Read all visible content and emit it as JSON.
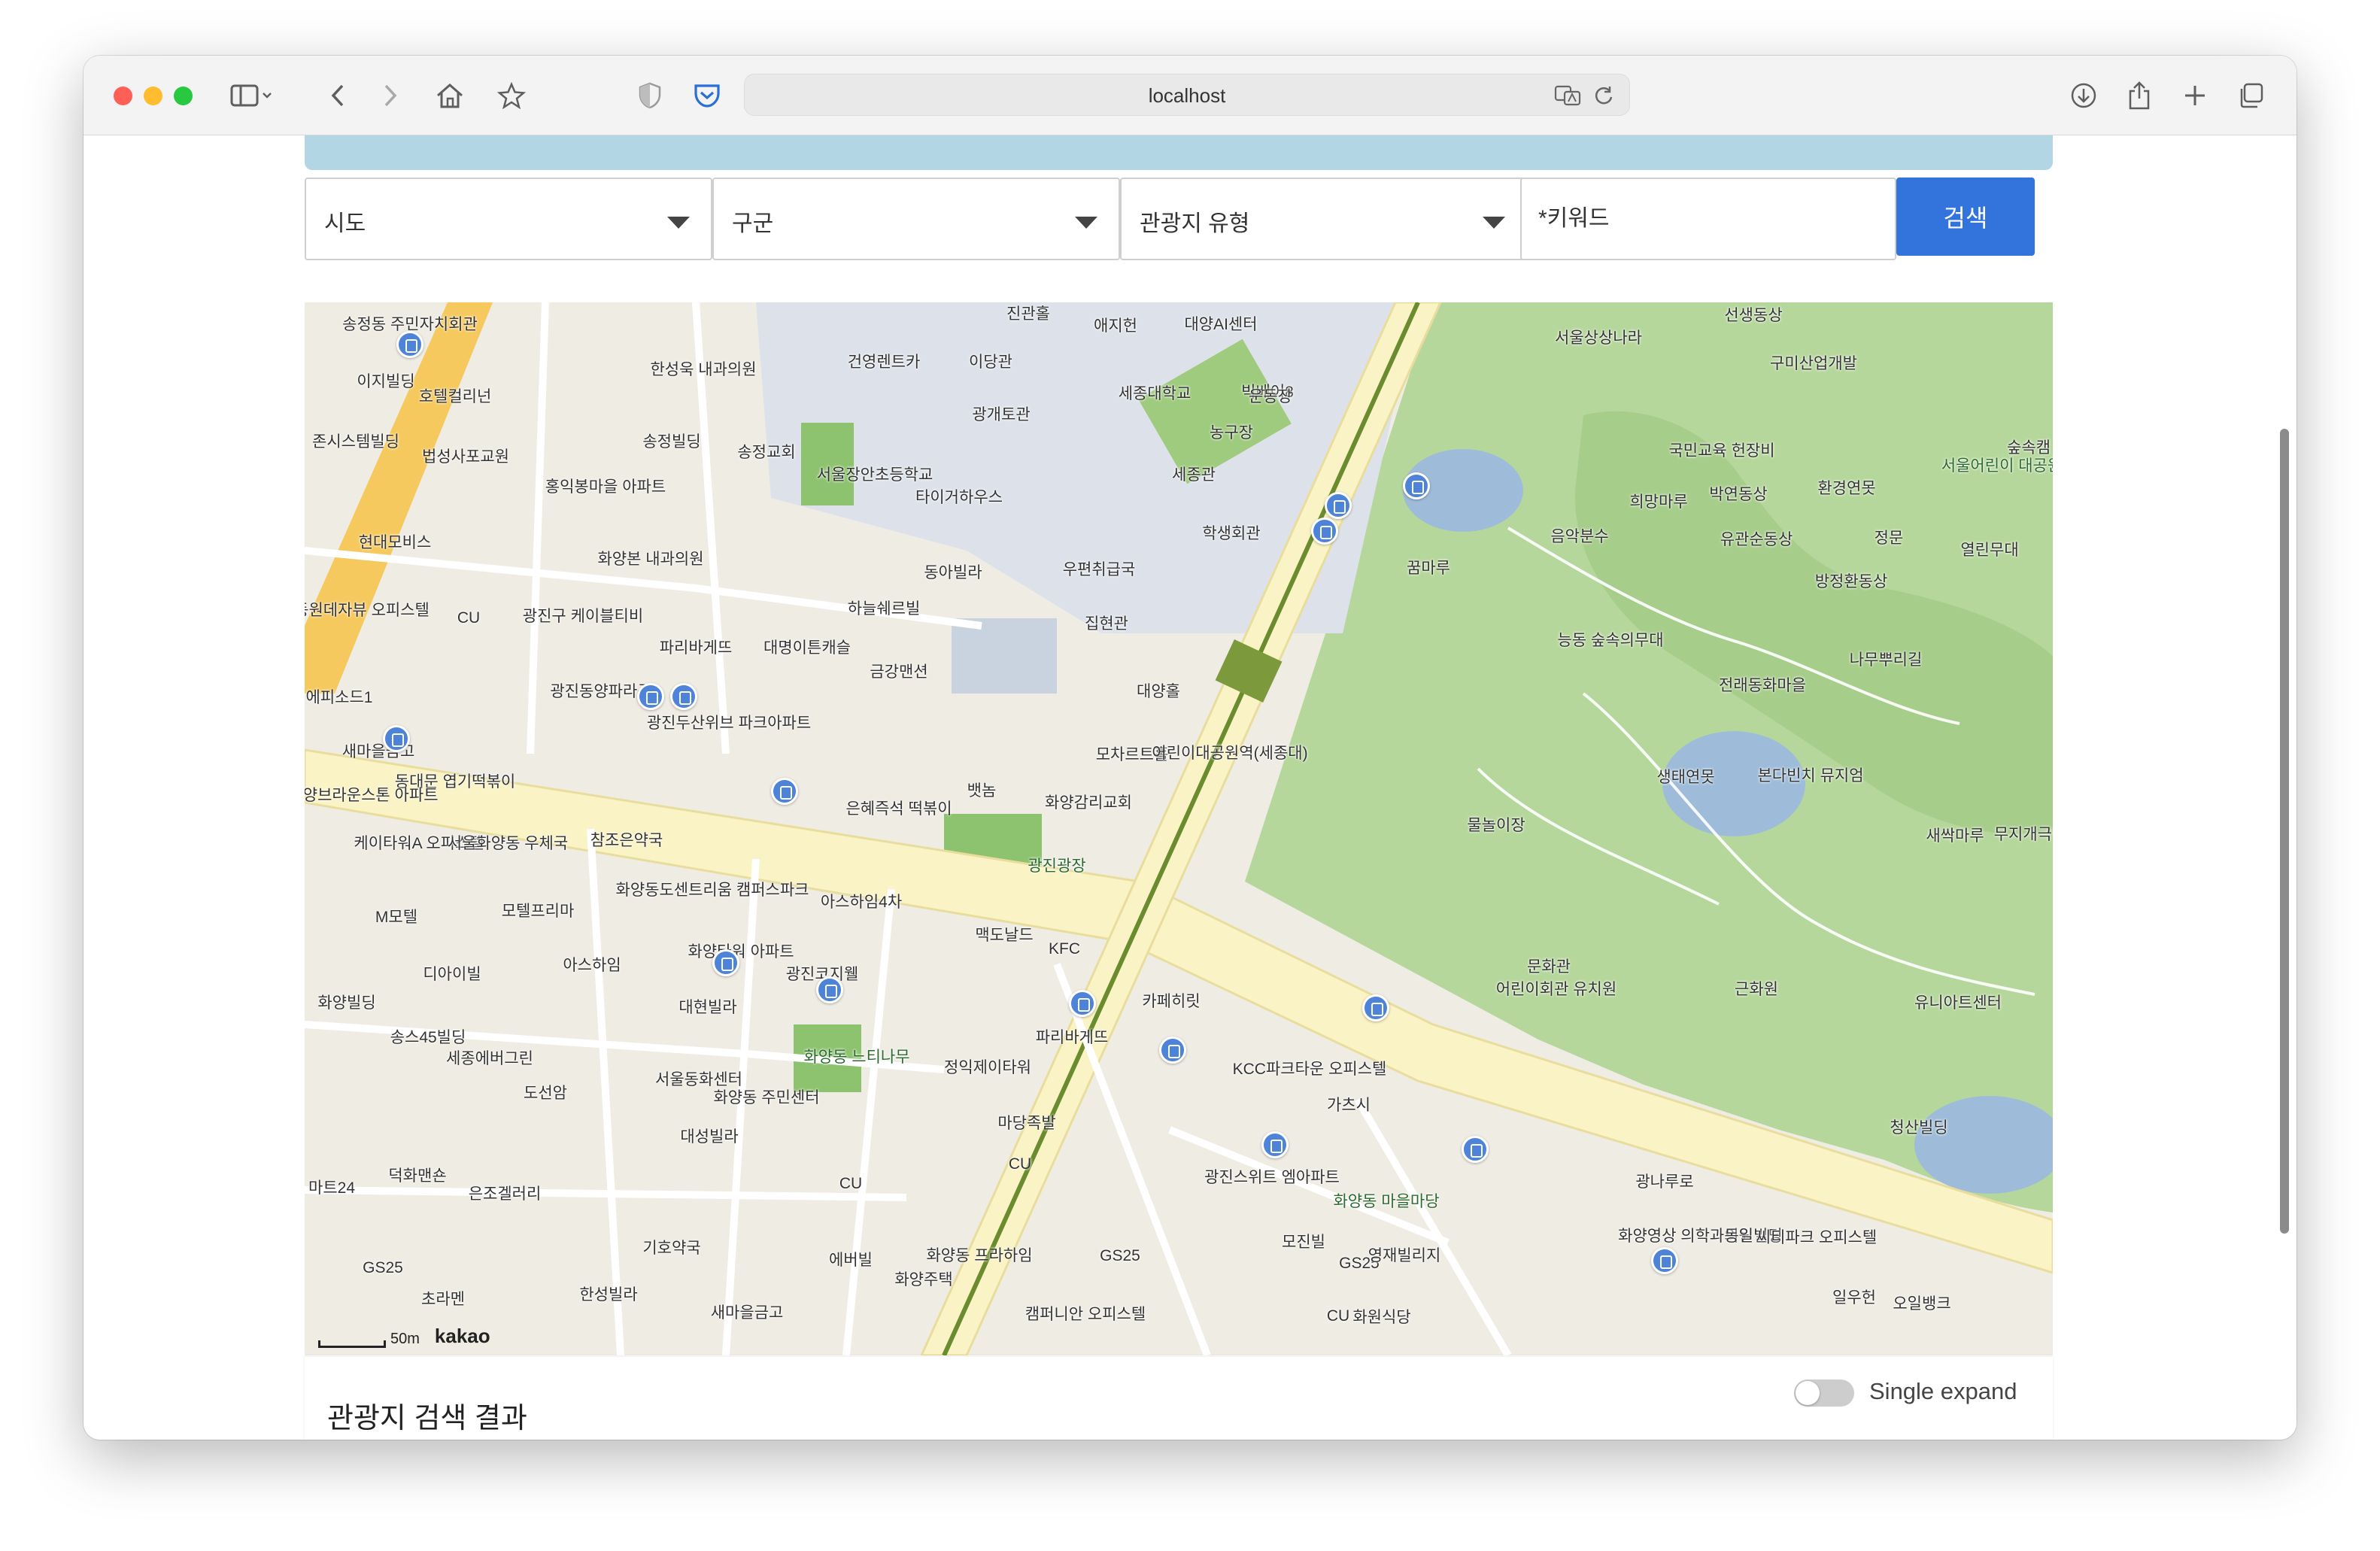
{
  "browser": {
    "url": "localhost"
  },
  "filters": {
    "sido": "시도",
    "gugun": "구군",
    "type": "관광지 유형",
    "keyword_placeholder": "*키워드",
    "search_label": "검색"
  },
  "map": {
    "scale_label": "50m",
    "logo": "kakao",
    "labels": [
      {
        "text": "송정동 주민자치회관"
      },
      {
        "text": "이지빌딩"
      },
      {
        "text": "호텔컬리넌"
      },
      {
        "text": "존시스템빌딩"
      },
      {
        "text": "법성사포교원"
      },
      {
        "text": "한성욱 내과의원"
      },
      {
        "text": "송정빌딩"
      },
      {
        "text": "송정교회"
      },
      {
        "text": "건영렌트카"
      },
      {
        "text": "서울장안초등학교"
      },
      {
        "text": "홍익봉마을 아파트"
      },
      {
        "text": "현대모비스"
      },
      {
        "text": "화양본 내과의원"
      },
      {
        "text": "동원데자뷰 오피스텔"
      },
      {
        "text": "CU"
      },
      {
        "text": "광진구 케이블티비"
      },
      {
        "text": "파리바게뜨"
      },
      {
        "text": "대명이튼캐슬"
      },
      {
        "text": "하늘쉐르빌"
      },
      {
        "text": "동아빌라"
      },
      {
        "text": "타이거하우스"
      },
      {
        "text": "금강맨션"
      },
      {
        "text": "에피소드1"
      },
      {
        "text": "광진동양파라곤"
      },
      {
        "text": "광진두산위브 파크아파트"
      },
      {
        "text": "새마을금고"
      },
      {
        "text": "동대문 엽기떡볶이"
      },
      {
        "text": "화양브라운스톤 아파트"
      },
      {
        "text": "참조은약국"
      },
      {
        "text": "은혜즉석 떡볶이"
      },
      {
        "text": "뱃놈"
      },
      {
        "text": "화양감리교회"
      },
      {
        "text": "광진광장"
      },
      {
        "text": "케이타워A 오피스텔"
      },
      {
        "text": "서울화양동 우체국"
      },
      {
        "text": "화양동도센트리움 캠퍼스파크"
      },
      {
        "text": "아스하임4차"
      },
      {
        "text": "M모텔"
      },
      {
        "text": "모텔프리마"
      },
      {
        "text": "맥도날드"
      },
      {
        "text": "KFC"
      },
      {
        "text": "디아이빌"
      },
      {
        "text": "아스하임"
      },
      {
        "text": "화양타워 아파트"
      },
      {
        "text": "광진코지웰"
      },
      {
        "text": "화양빌딩"
      },
      {
        "text": "대현빌라"
      },
      {
        "text": "송스45빌딩"
      },
      {
        "text": "세종에버그린"
      },
      {
        "text": "화양동 느티나무"
      },
      {
        "text": "서울동화센터"
      },
      {
        "text": "화양동 주민센터"
      },
      {
        "text": "정익제이타워"
      },
      {
        "text": "파리바게뜨"
      },
      {
        "text": "카페히릿"
      },
      {
        "text": "도선암"
      },
      {
        "text": "대성빌라"
      },
      {
        "text": "마당족발"
      },
      {
        "text": "덕화맨숀"
      },
      {
        "text": "은조겔러리"
      },
      {
        "text": "마트24"
      },
      {
        "text": "CU"
      },
      {
        "text": "CU"
      },
      {
        "text": "기호약국"
      },
      {
        "text": "에버빌"
      },
      {
        "text": "화양동 프라하임"
      },
      {
        "text": "화양주택"
      },
      {
        "text": "GS25"
      },
      {
        "text": "초라멘"
      },
      {
        "text": "한성빌라"
      },
      {
        "text": "새마을금고"
      },
      {
        "text": "GS25"
      },
      {
        "text": "캠퍼니안 오피스텔"
      },
      {
        "text": "세종대학교"
      },
      {
        "text": "진관홀"
      },
      {
        "text": "애지헌"
      },
      {
        "text": "대양AI센터"
      },
      {
        "text": "빅베어8"
      },
      {
        "text": "이당관"
      },
      {
        "text": "광개토관"
      },
      {
        "text": "운동장"
      },
      {
        "text": "농구장"
      },
      {
        "text": "세종관"
      },
      {
        "text": "학생회관"
      },
      {
        "text": "우편취급국"
      },
      {
        "text": "집현관"
      },
      {
        "text": "대양홀"
      },
      {
        "text": "모차르트홀"
      },
      {
        "text": "어린이대공원역(세종대)"
      },
      {
        "text": "광진스위트 엠아파트"
      },
      {
        "text": "KCC파크타운 오피스텔"
      },
      {
        "text": "가츠시"
      },
      {
        "text": "화양동 마을마당"
      },
      {
        "text": "GS25"
      },
      {
        "text": "모진빌"
      },
      {
        "text": "영재빌리지"
      },
      {
        "text": "화원식당"
      },
      {
        "text": "CU"
      },
      {
        "text": "서울상상나라"
      },
      {
        "text": "선생동상"
      },
      {
        "text": "구미산업개발"
      },
      {
        "text": "국민교육 헌장비"
      },
      {
        "text": "서울어린이 대공원"
      },
      {
        "text": "희망마루"
      },
      {
        "text": "박연동상"
      },
      {
        "text": "환경연못"
      },
      {
        "text": "음악분수"
      },
      {
        "text": "유관순동상"
      },
      {
        "text": "정문"
      },
      {
        "text": "꿈마루"
      },
      {
        "text": "방정환동상"
      },
      {
        "text": "열린무대"
      },
      {
        "text": "능동 숲속의무대"
      },
      {
        "text": "나무뿌리길"
      },
      {
        "text": "전래동화마을"
      },
      {
        "text": "생태연못"
      },
      {
        "text": "본다빈치 뮤지엄"
      },
      {
        "text": "물놀이장"
      },
      {
        "text": "새싹마루"
      },
      {
        "text": "무지개극장"
      },
      {
        "text": "문화관"
      },
      {
        "text": "어린이회관 유치원"
      },
      {
        "text": "근화원"
      },
      {
        "text": "유니아트센터"
      },
      {
        "text": "청산빌딩"
      },
      {
        "text": "광나루로"
      },
      {
        "text": "화양영상 의학과의원"
      },
      {
        "text": "동일빌딩"
      },
      {
        "text": "씨티파크 오피스텔"
      },
      {
        "text": "일우헌"
      },
      {
        "text": "오일뱅크"
      },
      {
        "text": "숲속캠"
      }
    ]
  },
  "results": {
    "title": "관광지 검색 결과",
    "single_expand_label": "Single expand"
  },
  "colors": {
    "search_button": "#3273dc",
    "park_green": "#b7d7a0",
    "major_road": "#f9f3c2",
    "subway_line": "#6b8c2e"
  }
}
